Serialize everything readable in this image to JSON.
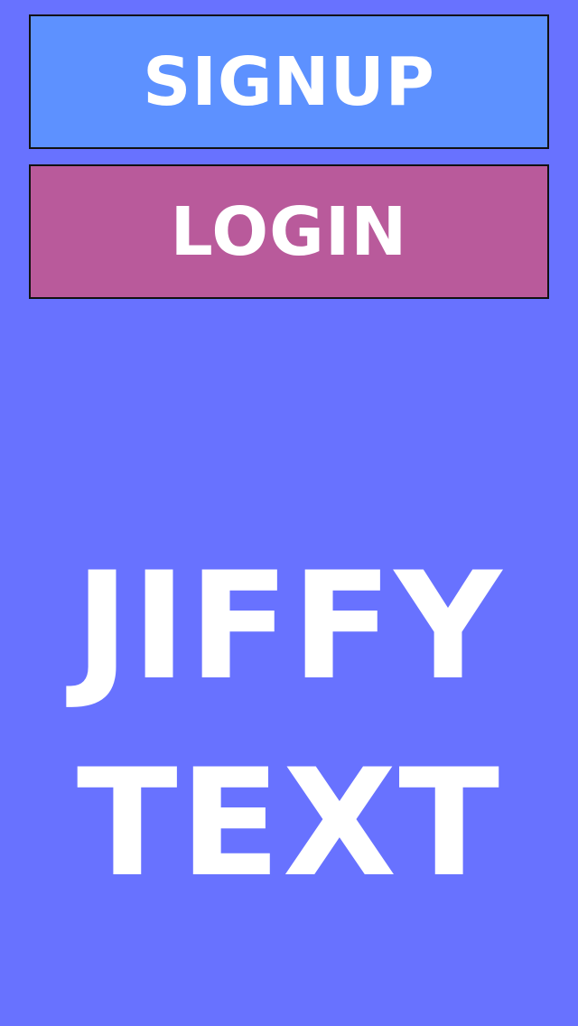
{
  "colors": {
    "background": "#6872FF",
    "signup_button": "#5D91FF",
    "login_button": "#B95A9B",
    "text": "#FFFFFF",
    "button_border": "#111111"
  },
  "buttons": {
    "signup_label": "SIGNUP",
    "login_label": "LOGIN"
  },
  "logo": {
    "line1": "JIFFY",
    "line2": "TEXT"
  }
}
